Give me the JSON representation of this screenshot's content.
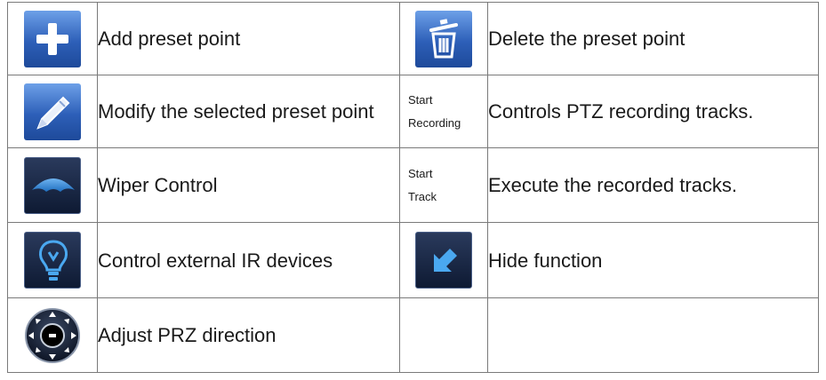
{
  "rows": [
    {
      "left": {
        "icon": "add-icon",
        "text": "Add preset point"
      },
      "right": {
        "icon": "trash-icon",
        "text": "Delete the preset point"
      }
    },
    {
      "left": {
        "icon": "pencil-icon",
        "text": "Modify the selected preset point"
      },
      "right": {
        "label_lines": [
          "Start",
          "Recording"
        ],
        "text": "Controls PTZ recording tracks."
      }
    },
    {
      "left": {
        "icon": "wiper-icon",
        "text": "Wiper Control"
      },
      "right": {
        "label_lines": [
          "Start",
          "Track"
        ],
        "text": "Execute the recorded tracks."
      }
    },
    {
      "left": {
        "icon": "lightbulb-icon",
        "text": "Control external IR devices"
      },
      "right": {
        "icon": "hide-arrow-icon",
        "text": "Hide function"
      }
    },
    {
      "left": {
        "icon": "direction-pad-icon",
        "text": "Adjust PRZ direction"
      },
      "right": {
        "text": ""
      }
    }
  ]
}
